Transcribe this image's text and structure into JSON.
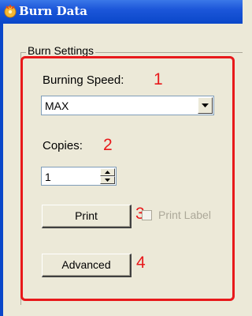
{
  "window": {
    "title": "Burn Data"
  },
  "group": {
    "label": "Burn Settings"
  },
  "burning_speed": {
    "label": "Burning Speed:",
    "value": "MAX",
    "marker": "1"
  },
  "copies": {
    "label": "Copies:",
    "value": "1",
    "marker": "2"
  },
  "print": {
    "button_label": "Print",
    "marker": "3",
    "checkbox_label": "Print Label",
    "checkbox_checked": false,
    "checkbox_enabled": false
  },
  "advanced": {
    "button_label": "Advanced",
    "marker": "4"
  },
  "icons": {
    "app": "burn-disc-icon",
    "dropdown": "chevron-down-icon",
    "spin_up": "spin-up-arrow-icon",
    "spin_down": "spin-down-arrow-icon"
  },
  "colors": {
    "highlight": "#e8191b",
    "titlebar": "#0a47c9",
    "window_bg": "#ece9d8"
  }
}
